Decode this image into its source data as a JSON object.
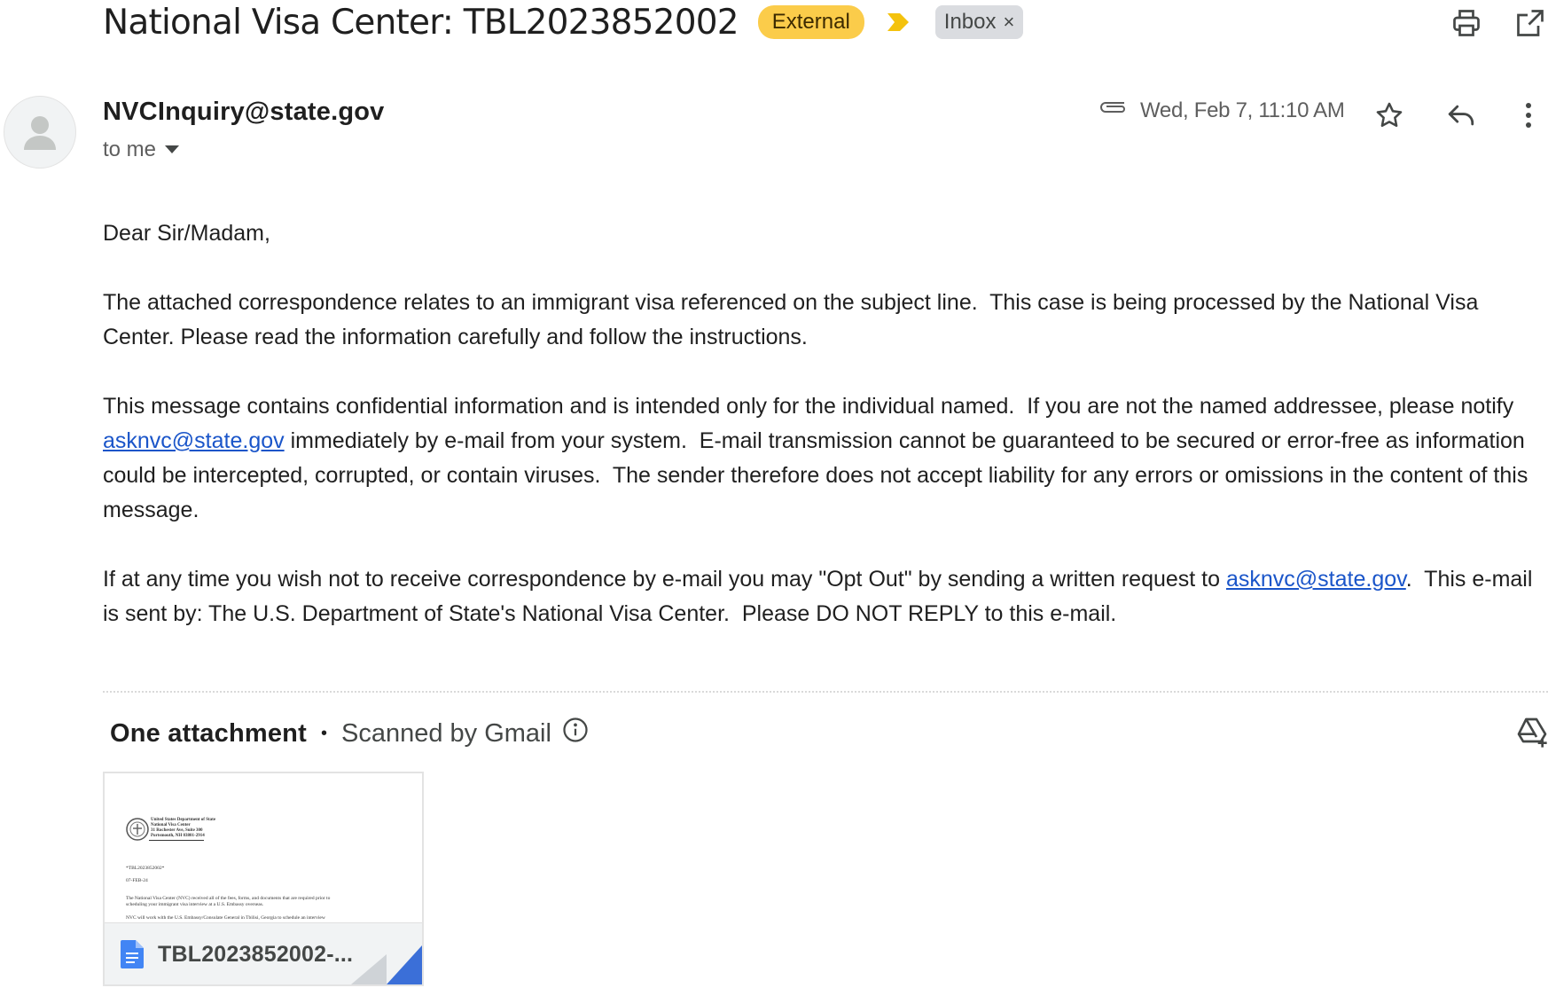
{
  "header": {
    "subject": "National Visa Center: TBL2023852002",
    "label_external": "External",
    "label_inbox": "Inbox",
    "label_inbox_remove": "×",
    "colors": {
      "external_bg": "#fbcc4a",
      "importance": "#f4c20d",
      "inbox_bg": "#dadce0"
    },
    "icons": [
      "print-icon",
      "open-in-new-window-icon"
    ]
  },
  "message": {
    "sender": "NVCInquiry@state.gov",
    "recipient_summary": "to me",
    "date": "Wed, Feb 7, 11:10 AM",
    "icons": [
      "attachment-icon",
      "star-icon",
      "reply-icon",
      "more-vert-icon"
    ]
  },
  "body": {
    "greeting": "Dear Sir/Madam,",
    "para1": "The attached correspondence relates to an immigrant visa referenced on the subject line.  This case is being processed by the National Visa Center. Please read the information carefully and follow the instructions.",
    "para2_before": "This message contains confidential information and is intended only for the individual named.  If you are not the named addressee, please notify ",
    "para2_link": "asknvc@state.gov",
    "para2_after": " immediately by e-mail from your system.  E-mail transmission cannot be guaranteed to be secured or error-free as information could be intercepted, corrupted, or contain viruses.  The sender therefore does not accept liability for any errors or omissions in the content of this message.",
    "para3_before": "If at any time you wish not to receive correspondence by e-mail you may \"Opt Out\" by sending a written request to ",
    "para3_link": "asknvc@state.gov",
    "para3_after": ".  This e-mail is sent by: The U.S. Department of State's National Visa Center.  Please DO NOT REPLY to this e-mail.",
    "link_color": "#1a55c9"
  },
  "attachments": {
    "title": "One attachment",
    "separator": "•",
    "scanned": "Scanned by Gmail",
    "file": {
      "name": "TBL2023852002-...",
      "preview": {
        "org_line1": "United States Department of State",
        "org_line2": "National Visa Center",
        "org_line3": "31 Rochester Ave, Suite 300",
        "org_line4": "Portsmouth, NH 03801-2914",
        "case": "*TBL2023852002*",
        "date": "07-FEB-24",
        "text1": "The National Visa Center (NVC) received all of the fees, forms, and documents that are required prior to",
        "text2": "scheduling your immigrant visa interview at a U.S. Embassy overseas.",
        "text3": "NVC will work with the U.S. Embassy/Consulate General in Tbilisi, Georgia to schedule an interview"
      }
    }
  }
}
